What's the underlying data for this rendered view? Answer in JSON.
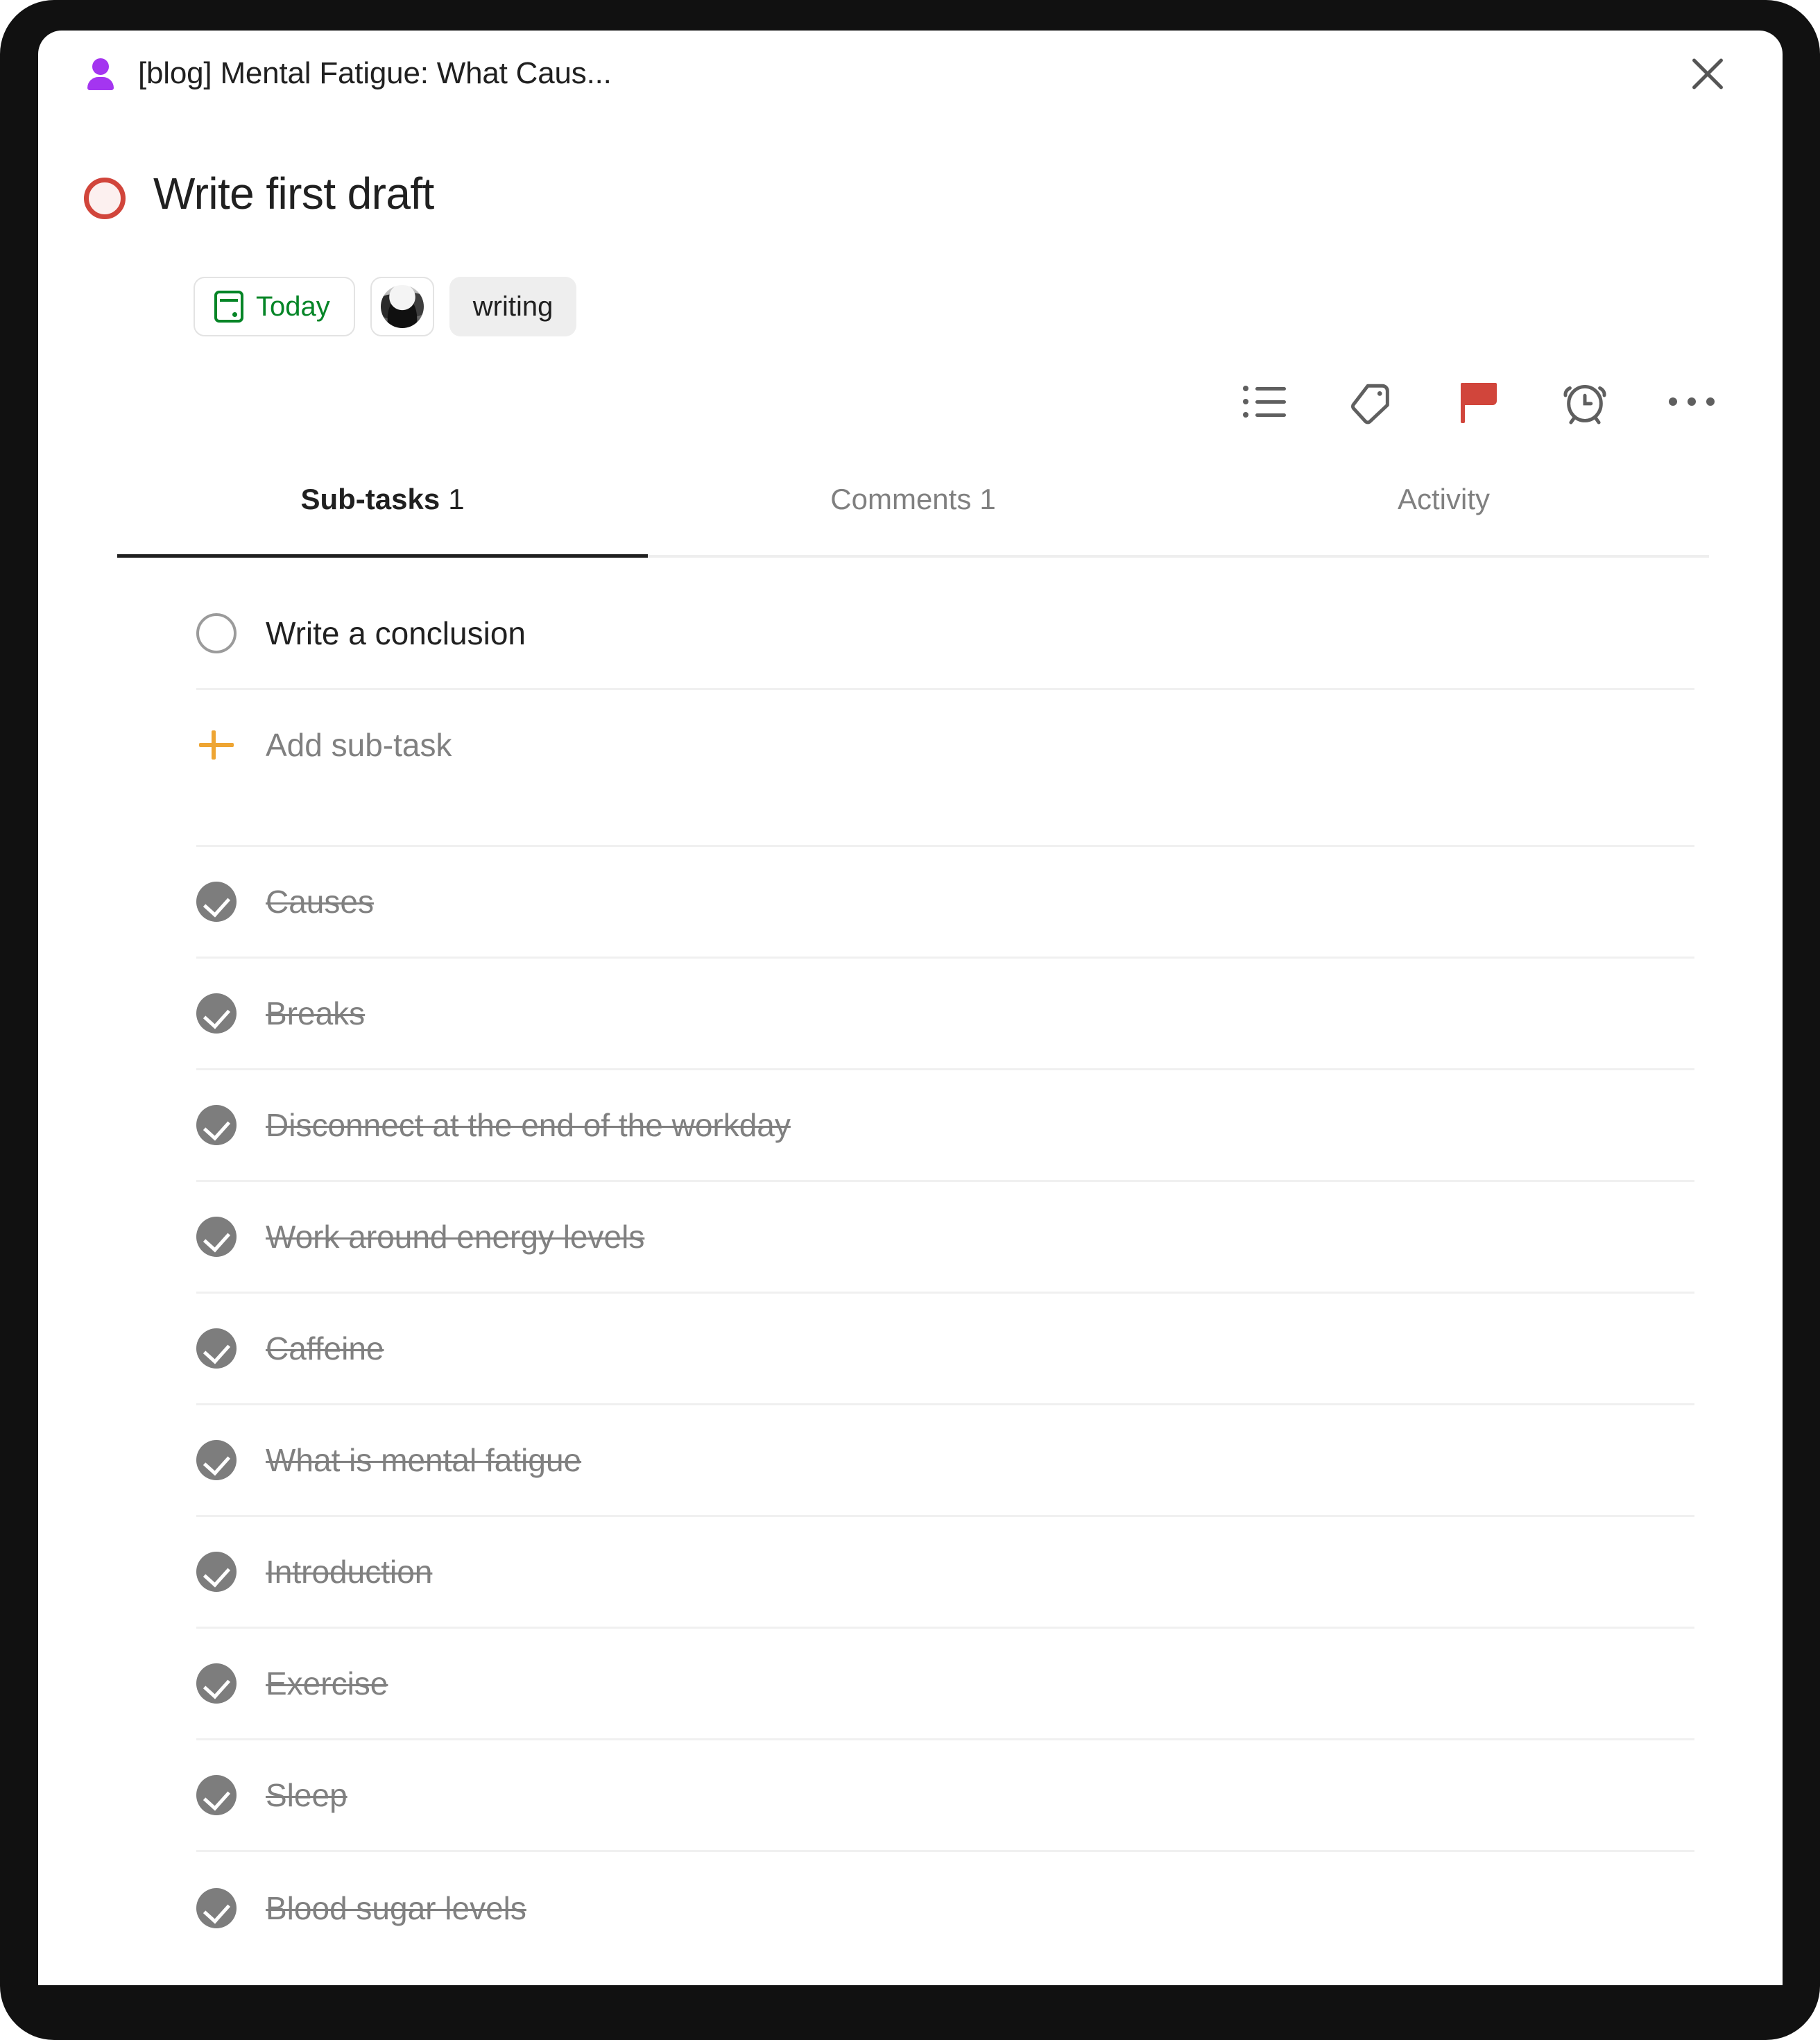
{
  "header": {
    "parent_project": "[blog] Mental Fatigue: What Caus...",
    "parent_icon": "person-icon",
    "close_icon": "close-icon"
  },
  "task": {
    "title": "Write first draft",
    "completed": false,
    "status_circle_color": "#D1453B"
  },
  "chips": {
    "due_date": "Today",
    "due_date_color": "#058527",
    "due_date_icon": "calendar-icon",
    "assignee_icon": "avatar",
    "tag": "writing"
  },
  "toolbar": {
    "items": [
      {
        "icon": "list-icon",
        "name": "subtask-list-button"
      },
      {
        "icon": "tag-icon",
        "name": "label-button"
      },
      {
        "icon": "flag-icon",
        "name": "priority-flag-button",
        "color": "#D1453B"
      },
      {
        "icon": "alarm-clock-icon",
        "name": "reminder-button"
      },
      {
        "icon": "ellipsis-icon",
        "name": "more-options-button"
      }
    ]
  },
  "tabs": [
    {
      "label": "Sub-tasks",
      "count": "1",
      "active": true
    },
    {
      "label": "Comments",
      "count": "1",
      "active": false
    },
    {
      "label": "Activity",
      "count": "",
      "active": false
    }
  ],
  "subtasks": {
    "open": [
      {
        "label": "Write a conclusion",
        "done": false
      }
    ],
    "add_label": "Add sub-task",
    "add_icon": "plus-icon",
    "completed": [
      {
        "label": "Causes",
        "done": true
      },
      {
        "label": "Breaks",
        "done": true
      },
      {
        "label": "Disconnect at the end of the workday",
        "done": true
      },
      {
        "label": "Work around energy levels",
        "done": true
      },
      {
        "label": "Caffeine",
        "done": true
      },
      {
        "label": "What is mental fatigue",
        "done": true
      },
      {
        "label": "Introduction",
        "done": true
      },
      {
        "label": "Exercise",
        "done": true
      },
      {
        "label": "Sleep",
        "done": true
      },
      {
        "label": "Blood sugar levels",
        "done": true
      }
    ]
  }
}
